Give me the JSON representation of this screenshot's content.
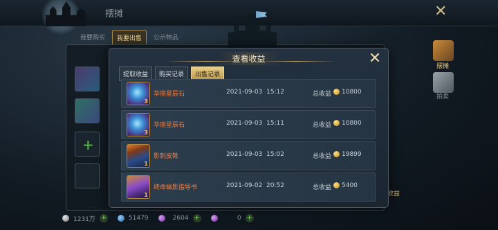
{
  "background": {
    "title": "摆摊",
    "tabs": [
      {
        "label": "我要购买",
        "active": false
      },
      {
        "label": "我要出售",
        "active": true
      },
      {
        "label": "公示物品",
        "active": false
      }
    ],
    "side_buttons": [
      {
        "label": "摆摊",
        "icon": "treasure-chest-icon"
      },
      {
        "label": "拍卖",
        "icon": "auction-icon"
      }
    ],
    "right_fragment": "收益"
  },
  "currency_bar": [
    {
      "icon": "silver-coin-icon",
      "value": "1231万"
    },
    {
      "icon": "blue-gem-icon",
      "value": "51479"
    },
    {
      "icon": "purple-crystal-icon",
      "value": "2604"
    },
    {
      "icon": "purple-crystal-icon",
      "value": "0"
    }
  ],
  "modal": {
    "title": "查看收益",
    "tabs": [
      {
        "label": "提取收益",
        "active": false
      },
      {
        "label": "购买记录",
        "active": false
      },
      {
        "label": "出售记录",
        "active": true
      }
    ],
    "total_label": "总收益",
    "records": [
      {
        "item": "华丽星辰石",
        "icon": "star-stone-icon",
        "qty": "3",
        "date": "2021-09-03  15:12",
        "amount": "10800",
        "color": "#5aa9e8"
      },
      {
        "item": "华丽星辰石",
        "icon": "star-stone-icon",
        "qty": "3",
        "date": "2021-09-03  15:11",
        "amount": "10800",
        "color": "#5aa9e8"
      },
      {
        "item": "影刺皮靴",
        "icon": "boots-icon",
        "qty": "1",
        "date": "2021-09-03  15:02",
        "amount": "19899",
        "color": "#3b6fb0"
      },
      {
        "item": "终命幽影指导书",
        "icon": "book-icon",
        "qty": "1",
        "date": "2021-09-02  20:52",
        "amount": "5400",
        "color": "#8a4cc8"
      }
    ]
  },
  "colors": {
    "accent_gold": "#e9cf86",
    "item_name": "#ee7f44",
    "panel_bg": "#233140"
  }
}
